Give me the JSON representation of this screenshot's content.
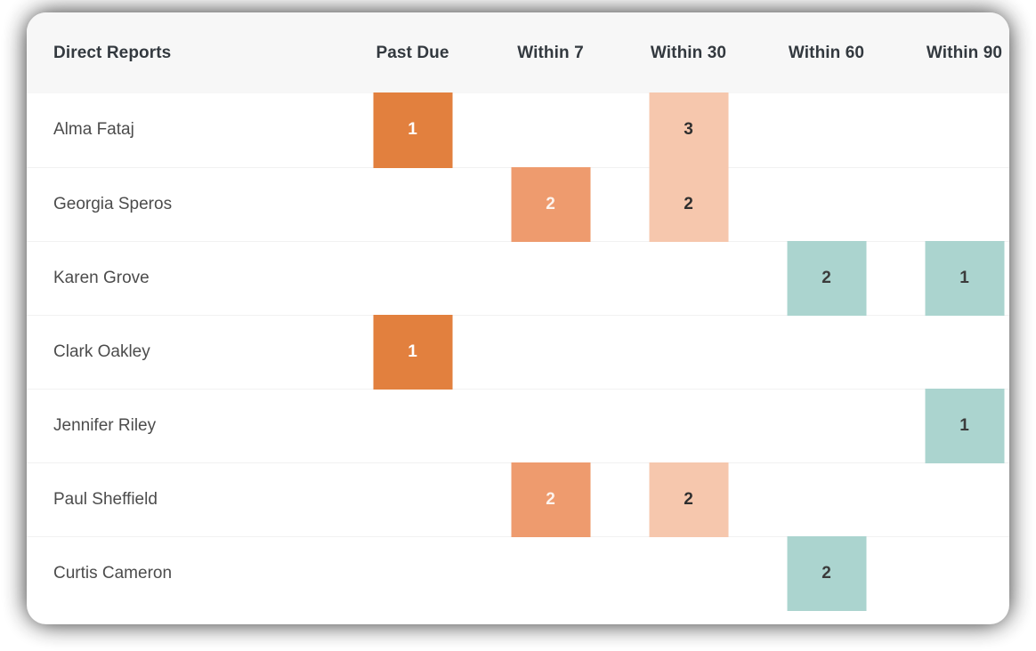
{
  "card": {
    "accent_dark_orange": "#e2803e",
    "accent_mid_orange": "#ee9b6e",
    "accent_light_orange": "#f6c7ad",
    "accent_teal": "#abd4cf",
    "header_background": "#f7f7f7",
    "row_divider": "#f1f1f1"
  },
  "table": {
    "columns": [
      {
        "key": "name",
        "label": "Direct Reports",
        "align": "left"
      },
      {
        "key": "past",
        "label": "Past Due",
        "align": "center"
      },
      {
        "key": "w7",
        "label": "Within 7",
        "align": "center"
      },
      {
        "key": "w30",
        "label": "Within 30",
        "align": "center"
      },
      {
        "key": "w60",
        "label": "Within 60",
        "align": "center"
      },
      {
        "key": "w90",
        "label": "Within 90",
        "align": "center"
      }
    ],
    "rows": [
      {
        "name": "Alma Fataj",
        "cells": [
          {
            "value": "1",
            "level": "dark"
          },
          {
            "value": "",
            "level": "empty"
          },
          {
            "value": "3",
            "level": "light"
          },
          {
            "value": "",
            "level": "empty"
          },
          {
            "value": "",
            "level": "empty"
          }
        ]
      },
      {
        "name": "Georgia Speros",
        "cells": [
          {
            "value": "",
            "level": "empty"
          },
          {
            "value": "2",
            "level": "mid"
          },
          {
            "value": "2",
            "level": "light"
          },
          {
            "value": "",
            "level": "empty"
          },
          {
            "value": "",
            "level": "empty"
          }
        ]
      },
      {
        "name": "Karen Grove",
        "cells": [
          {
            "value": "",
            "level": "empty"
          },
          {
            "value": "",
            "level": "empty"
          },
          {
            "value": "",
            "level": "empty"
          },
          {
            "value": "2",
            "level": "teal"
          },
          {
            "value": "1",
            "level": "teal"
          }
        ]
      },
      {
        "name": "Clark Oakley",
        "cells": [
          {
            "value": "1",
            "level": "dark"
          },
          {
            "value": "",
            "level": "empty"
          },
          {
            "value": "",
            "level": "empty"
          },
          {
            "value": "",
            "level": "empty"
          },
          {
            "value": "",
            "level": "empty"
          }
        ]
      },
      {
        "name": "Jennifer Riley",
        "cells": [
          {
            "value": "",
            "level": "empty"
          },
          {
            "value": "",
            "level": "empty"
          },
          {
            "value": "",
            "level": "empty"
          },
          {
            "value": "",
            "level": "empty"
          },
          {
            "value": "1",
            "level": "teal"
          }
        ]
      },
      {
        "name": "Paul Sheffield",
        "cells": [
          {
            "value": "",
            "level": "empty"
          },
          {
            "value": "2",
            "level": "mid"
          },
          {
            "value": "2",
            "level": "light"
          },
          {
            "value": "",
            "level": "empty"
          },
          {
            "value": "",
            "level": "empty"
          }
        ]
      },
      {
        "name": "Curtis Cameron",
        "cells": [
          {
            "value": "",
            "level": "empty"
          },
          {
            "value": "",
            "level": "empty"
          },
          {
            "value": "",
            "level": "empty"
          },
          {
            "value": "2",
            "level": "teal"
          },
          {
            "value": "",
            "level": "empty"
          }
        ]
      }
    ]
  },
  "chart_data": {
    "type": "heatmap",
    "title": "",
    "xlabel": "",
    "ylabel": "",
    "categories": [
      "Past Due",
      "Within 7",
      "Within 30",
      "Within 60",
      "Within 90"
    ],
    "rows": [
      "Alma Fataj",
      "Georgia Speros",
      "Karen Grove",
      "Clark Oakley",
      "Jennifer Riley",
      "Paul Sheffield",
      "Curtis Cameron"
    ],
    "values": [
      [
        1,
        null,
        3,
        null,
        null
      ],
      [
        null,
        2,
        2,
        null,
        null
      ],
      [
        null,
        null,
        null,
        2,
        1
      ],
      [
        1,
        null,
        null,
        null,
        null
      ],
      [
        null,
        null,
        null,
        null,
        1
      ],
      [
        null,
        2,
        2,
        null,
        null
      ],
      [
        null,
        null,
        null,
        2,
        null
      ]
    ],
    "color_scale": {
      "dark": "#e2803e",
      "mid": "#ee9b6e",
      "light": "#f6c7ad",
      "teal": "#abd4cf"
    },
    "legend_position": "none",
    "grid": false
  }
}
